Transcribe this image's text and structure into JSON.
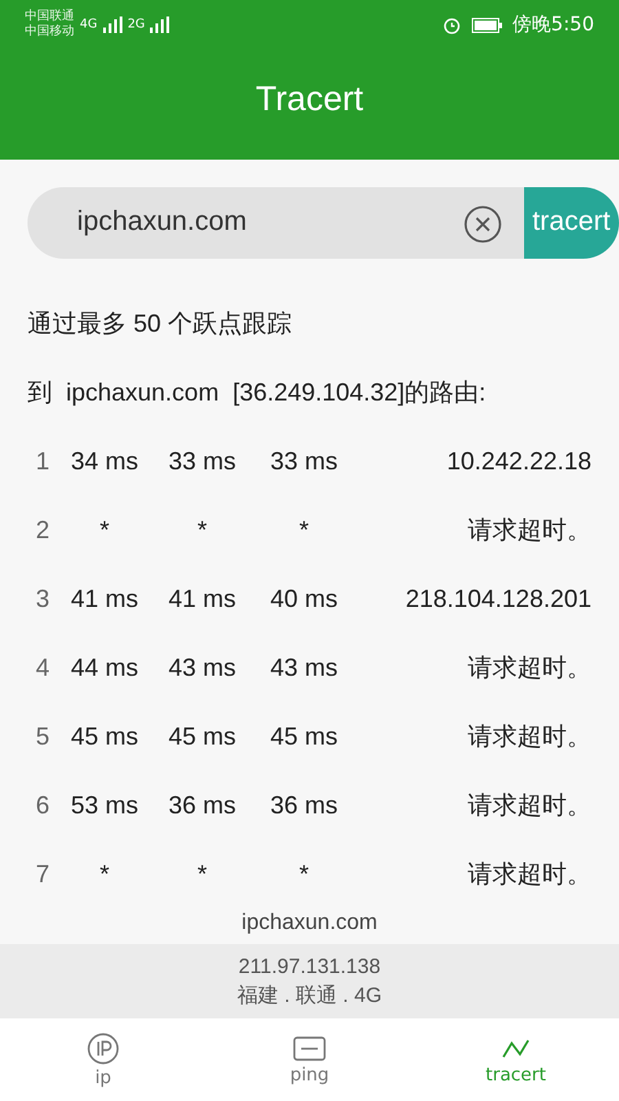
{
  "status_bar": {
    "carriers": [
      "中国联通",
      "中国移动"
    ],
    "network_1": "4G",
    "network_2": "2G",
    "time": "傍晚5:50"
  },
  "window": {
    "title": "Tracert"
  },
  "search": {
    "value": "ipchaxun.com",
    "button": "tracert"
  },
  "intro": "通过最多 50 个跃点跟踪",
  "route_line": "到  ipchaxun.com  [36.249.104.32]的路由:",
  "hops": [
    {
      "index": "1",
      "t1": "34 ms",
      "t2": "33 ms",
      "t3": "33 ms",
      "result": "10.242.22.18"
    },
    {
      "index": "2",
      "t1": "*",
      "t2": "*",
      "t3": "*",
      "result": "请求超时。"
    },
    {
      "index": "3",
      "t1": "41 ms",
      "t2": "41 ms",
      "t3": "40 ms",
      "result": "218.104.128.201"
    },
    {
      "index": "4",
      "t1": "44 ms",
      "t2": "43 ms",
      "t3": "43 ms",
      "result": "请求超时。"
    },
    {
      "index": "5",
      "t1": "45 ms",
      "t2": "45 ms",
      "t3": "45 ms",
      "result": "请求超时。"
    },
    {
      "index": "6",
      "t1": "53 ms",
      "t2": "36 ms",
      "t3": "36 ms",
      "result": "请求超时。"
    },
    {
      "index": "7",
      "t1": "*",
      "t2": "*",
      "t3": "*",
      "result": "请求超时。"
    }
  ],
  "footer": {
    "domain": "ipchaxun.com",
    "ip": "211.97.131.138",
    "location": "福建 . 联通 . 4G"
  },
  "tabs": [
    {
      "label": "ip",
      "kind": "ip",
      "selected": false
    },
    {
      "label": "ping",
      "kind": "ping",
      "selected": false
    },
    {
      "label": "tracert",
      "kind": "tracert",
      "selected": true
    }
  ]
}
